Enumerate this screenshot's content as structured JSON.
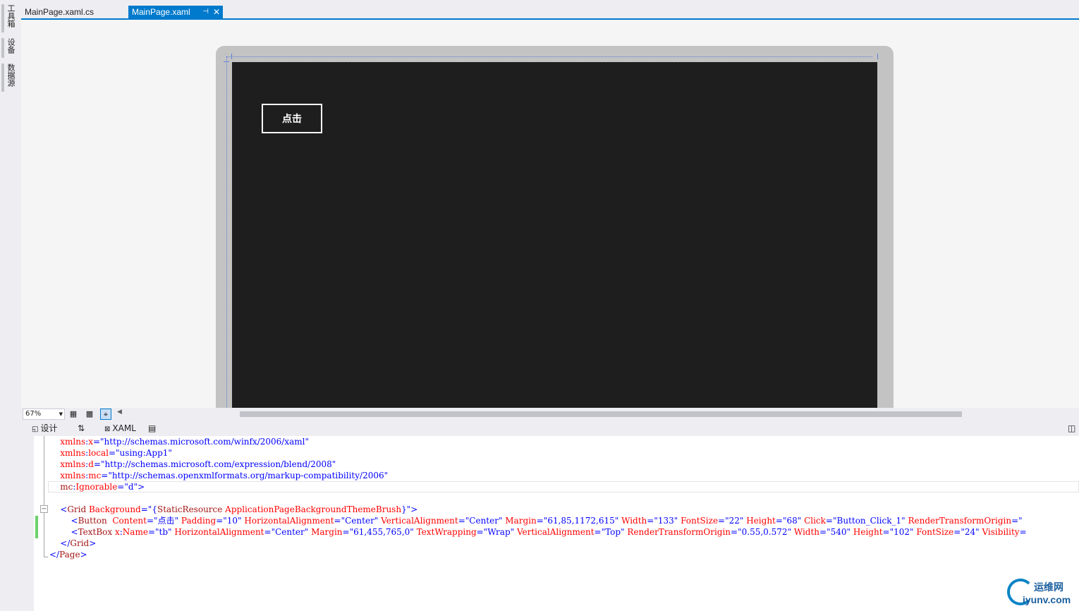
{
  "side_panels": [
    "工具箱",
    "设备",
    "数据源"
  ],
  "tabs": [
    {
      "label": "MainPage.xaml.cs",
      "active": false
    },
    {
      "label": "MainPage.xaml",
      "active": true
    }
  ],
  "tab_icons": {
    "pin": "pin-icon",
    "close": "close-icon"
  },
  "designer": {
    "button_content": "点击"
  },
  "designer_bar": {
    "zoom": "67%"
  },
  "split": {
    "design_label": "设计",
    "swap_label": "⇅",
    "xaml_label": "XAML"
  },
  "code_lines": [
    [
      [
        "    xmlns",
        "rd"
      ],
      [
        ":",
        "bl"
      ],
      [
        "x",
        "rd"
      ],
      [
        "=",
        "bl"
      ],
      [
        "\"http://schemas.microsoft.com/winfx/2006/xaml\"",
        "bl"
      ]
    ],
    [
      [
        "    xmlns",
        "rd"
      ],
      [
        ":",
        "bl"
      ],
      [
        "local",
        "rd"
      ],
      [
        "=",
        "bl"
      ],
      [
        "\"using:App1\"",
        "bl"
      ]
    ],
    [
      [
        "    xmlns",
        "rd"
      ],
      [
        ":",
        "bl"
      ],
      [
        "d",
        "rd"
      ],
      [
        "=",
        "bl"
      ],
      [
        "\"http://schemas.microsoft.com/expression/blend/2008\"",
        "bl"
      ]
    ],
    [
      [
        "    xmlns",
        "rd"
      ],
      [
        ":",
        "bl"
      ],
      [
        "mc",
        "rd"
      ],
      [
        "=",
        "bl"
      ],
      [
        "\"http://schemas.openxmlformats.org/markup-compatibility/2006\"",
        "bl"
      ]
    ],
    [
      [
        "    mc",
        "br"
      ],
      [
        ":",
        "bl"
      ],
      [
        "Ignorable",
        "rd"
      ],
      [
        "=",
        "bl"
      ],
      [
        "\"d\"",
        "bl"
      ],
      [
        ">",
        "bl"
      ]
    ],
    [],
    [
      [
        "    ",
        "bk"
      ],
      [
        "<",
        "bl"
      ],
      [
        "Grid",
        "br"
      ],
      [
        " Background",
        "rd"
      ],
      [
        "=",
        "bl"
      ],
      [
        "\"",
        "bl"
      ],
      [
        "{",
        "bl"
      ],
      [
        "StaticResource",
        "br"
      ],
      [
        " ApplicationPageBackgroundThemeBrush",
        "rd"
      ],
      [
        "}",
        "bl"
      ],
      [
        "\"",
        "bl"
      ],
      [
        ">",
        "bl"
      ]
    ],
    [
      [
        "        ",
        "bk"
      ],
      [
        "<",
        "bl"
      ],
      [
        "Button",
        "br"
      ],
      [
        "  Content",
        "rd"
      ],
      [
        "=",
        "bl"
      ],
      [
        "\"点击\"",
        "bl"
      ],
      [
        " Padding",
        "rd"
      ],
      [
        "=",
        "bl"
      ],
      [
        "\"10\"",
        "bl"
      ],
      [
        " HorizontalAlignment",
        "rd"
      ],
      [
        "=",
        "bl"
      ],
      [
        "\"Center\"",
        "bl"
      ],
      [
        " VerticalAlignment",
        "rd"
      ],
      [
        "=",
        "bl"
      ],
      [
        "\"Center\"",
        "bl"
      ],
      [
        " Margin",
        "rd"
      ],
      [
        "=",
        "bl"
      ],
      [
        "\"61,85,1172,615\"",
        "bl"
      ],
      [
        " Width",
        "rd"
      ],
      [
        "=",
        "bl"
      ],
      [
        "\"133\"",
        "bl"
      ],
      [
        " FontSize",
        "rd"
      ],
      [
        "=",
        "bl"
      ],
      [
        "\"22\"",
        "bl"
      ],
      [
        " Height",
        "rd"
      ],
      [
        "=",
        "bl"
      ],
      [
        "\"68\"",
        "bl"
      ],
      [
        " Click",
        "rd"
      ],
      [
        "=",
        "bl"
      ],
      [
        "\"Button_Click_1\"",
        "bl"
      ],
      [
        " RenderTransformOrigin",
        "rd"
      ],
      [
        "=",
        "bl"
      ],
      [
        "\"",
        "bl"
      ]
    ],
    [
      [
        "        ",
        "bk"
      ],
      [
        "<",
        "bl"
      ],
      [
        "TextBox",
        "br"
      ],
      [
        " x",
        "rd"
      ],
      [
        ":",
        "bl"
      ],
      [
        "Name",
        "rd"
      ],
      [
        "=",
        "bl"
      ],
      [
        "\"tb\"",
        "bl"
      ],
      [
        " HorizontalAlignment",
        "rd"
      ],
      [
        "=",
        "bl"
      ],
      [
        "\"Center\"",
        "bl"
      ],
      [
        " Margin",
        "rd"
      ],
      [
        "=",
        "bl"
      ],
      [
        "\"61,455,765,0\"",
        "bl"
      ],
      [
        " TextWrapping",
        "rd"
      ],
      [
        "=",
        "bl"
      ],
      [
        "\"Wrap\"",
        "bl"
      ],
      [
        " VerticalAlignment",
        "rd"
      ],
      [
        "=",
        "bl"
      ],
      [
        "\"Top\"",
        "bl"
      ],
      [
        " RenderTransformOrigin",
        "rd"
      ],
      [
        "=",
        "bl"
      ],
      [
        "\"0.55,0.572\"",
        "bl"
      ],
      [
        " Width",
        "rd"
      ],
      [
        "=",
        "bl"
      ],
      [
        "\"540\"",
        "bl"
      ],
      [
        " Height",
        "rd"
      ],
      [
        "=",
        "bl"
      ],
      [
        "\"102\"",
        "bl"
      ],
      [
        " FontSize",
        "rd"
      ],
      [
        "=",
        "bl"
      ],
      [
        "\"24\"",
        "bl"
      ],
      [
        " Visibility",
        "rd"
      ],
      [
        "=",
        "bl"
      ]
    ],
    [
      [
        "    ",
        "bk"
      ],
      [
        "</",
        "bl"
      ],
      [
        "Grid",
        "br"
      ],
      [
        ">",
        "bl"
      ]
    ],
    [
      [
        "</",
        "bl"
      ],
      [
        "Page",
        "br"
      ],
      [
        ">",
        "bl"
      ]
    ]
  ],
  "watermark": {
    "cn": "运维网",
    "en": "iyunv.com"
  }
}
